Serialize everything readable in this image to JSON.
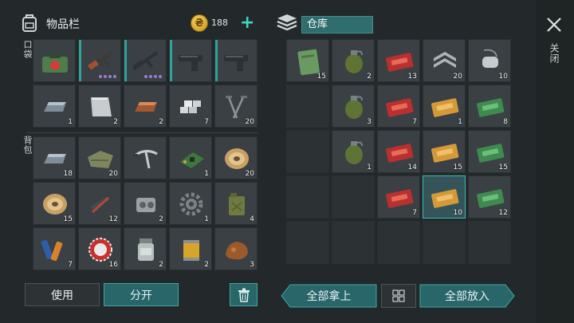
{
  "inventory": {
    "title": "物品栏",
    "coins": "188",
    "pocket_label": "口袋",
    "backpack_label": "背包",
    "pocket_slots": [
      {
        "icon": "medkit-bag-icon",
        "count": ""
      },
      {
        "icon": "ak-rifle-icon",
        "count": ""
      },
      {
        "icon": "assault-rifle-icon",
        "count": ""
      },
      {
        "icon": "pistol-icon",
        "count": ""
      },
      {
        "icon": "pistol-icon",
        "count": ""
      },
      {
        "icon": "iron-ingot-icon",
        "count": "1"
      },
      {
        "icon": "aluminum-plate-icon",
        "count": "2"
      },
      {
        "icon": "copper-ingot-icon",
        "count": "2"
      },
      {
        "icon": "silver-bars-icon",
        "count": "7"
      },
      {
        "icon": "nails-icon",
        "count": "20"
      }
    ],
    "backpack_slots": [
      {
        "icon": "iron-ingot-icon",
        "count": "18"
      },
      {
        "icon": "cloth-icon",
        "count": "20"
      },
      {
        "icon": "handlebar-icon",
        "count": ""
      },
      {
        "icon": "circuit-board-icon",
        "count": "1"
      },
      {
        "icon": "wire-spool-icon",
        "count": "20"
      },
      {
        "icon": "wire-spool-icon",
        "count": "15"
      },
      {
        "icon": "tools-icon",
        "count": "12"
      },
      {
        "icon": "engine-part-icon",
        "count": "2"
      },
      {
        "icon": "gear-icon",
        "count": "1"
      },
      {
        "icon": "jerry-can-icon",
        "count": "4"
      },
      {
        "icon": "batteries-icon",
        "count": "7"
      },
      {
        "icon": "bottle-cap-icon",
        "count": "16"
      },
      {
        "icon": "jar-icon",
        "count": "2"
      },
      {
        "icon": "filter-icon",
        "count": "2"
      },
      {
        "icon": "ore-icon",
        "count": "3"
      }
    ],
    "use_button": "使用",
    "split_button": "分开"
  },
  "storage": {
    "title": "仓库",
    "rows": [
      [
        {
          "icon": "notebook-icon",
          "count": "15"
        },
        {
          "icon": "grenade-icon",
          "count": "2"
        },
        {
          "icon": "red-coupon-icon",
          "count": "13"
        },
        {
          "icon": "rank-badge-icon",
          "count": "20"
        },
        {
          "icon": "dog-tag-icon",
          "count": "10"
        }
      ],
      [
        {
          "icon": "",
          "count": ""
        },
        {
          "icon": "grenade-icon",
          "count": "3"
        },
        {
          "icon": "red-coupon-icon",
          "count": "7"
        },
        {
          "icon": "gold-coupon-icon",
          "count": "1"
        },
        {
          "icon": "green-coupon-icon",
          "count": "8"
        }
      ],
      [
        {
          "icon": "",
          "count": ""
        },
        {
          "icon": "grenade-icon",
          "count": "1"
        },
        {
          "icon": "red-coupon-icon",
          "count": "14"
        },
        {
          "icon": "gold-coupon-icon",
          "count": "15"
        },
        {
          "icon": "green-coupon-icon",
          "count": "15"
        }
      ],
      [
        {
          "icon": "",
          "count": ""
        },
        {
          "icon": "",
          "count": ""
        },
        {
          "icon": "red-coupon-icon",
          "count": "7"
        },
        {
          "icon": "gold-coupon-icon",
          "count": "10"
        },
        {
          "icon": "green-coupon-icon",
          "count": "12"
        }
      ],
      [
        {
          "icon": "",
          "count": ""
        },
        {
          "icon": "",
          "count": ""
        },
        {
          "icon": "",
          "count": ""
        },
        {
          "icon": "",
          "count": ""
        },
        {
          "icon": "",
          "count": ""
        }
      ]
    ],
    "take_all_button": "全部拿上",
    "put_all_button": "全部放入"
  },
  "close_label": "关闭",
  "colors": {
    "accent": "#3da9a1",
    "background": "#23282a",
    "slot": "#3a4043"
  }
}
